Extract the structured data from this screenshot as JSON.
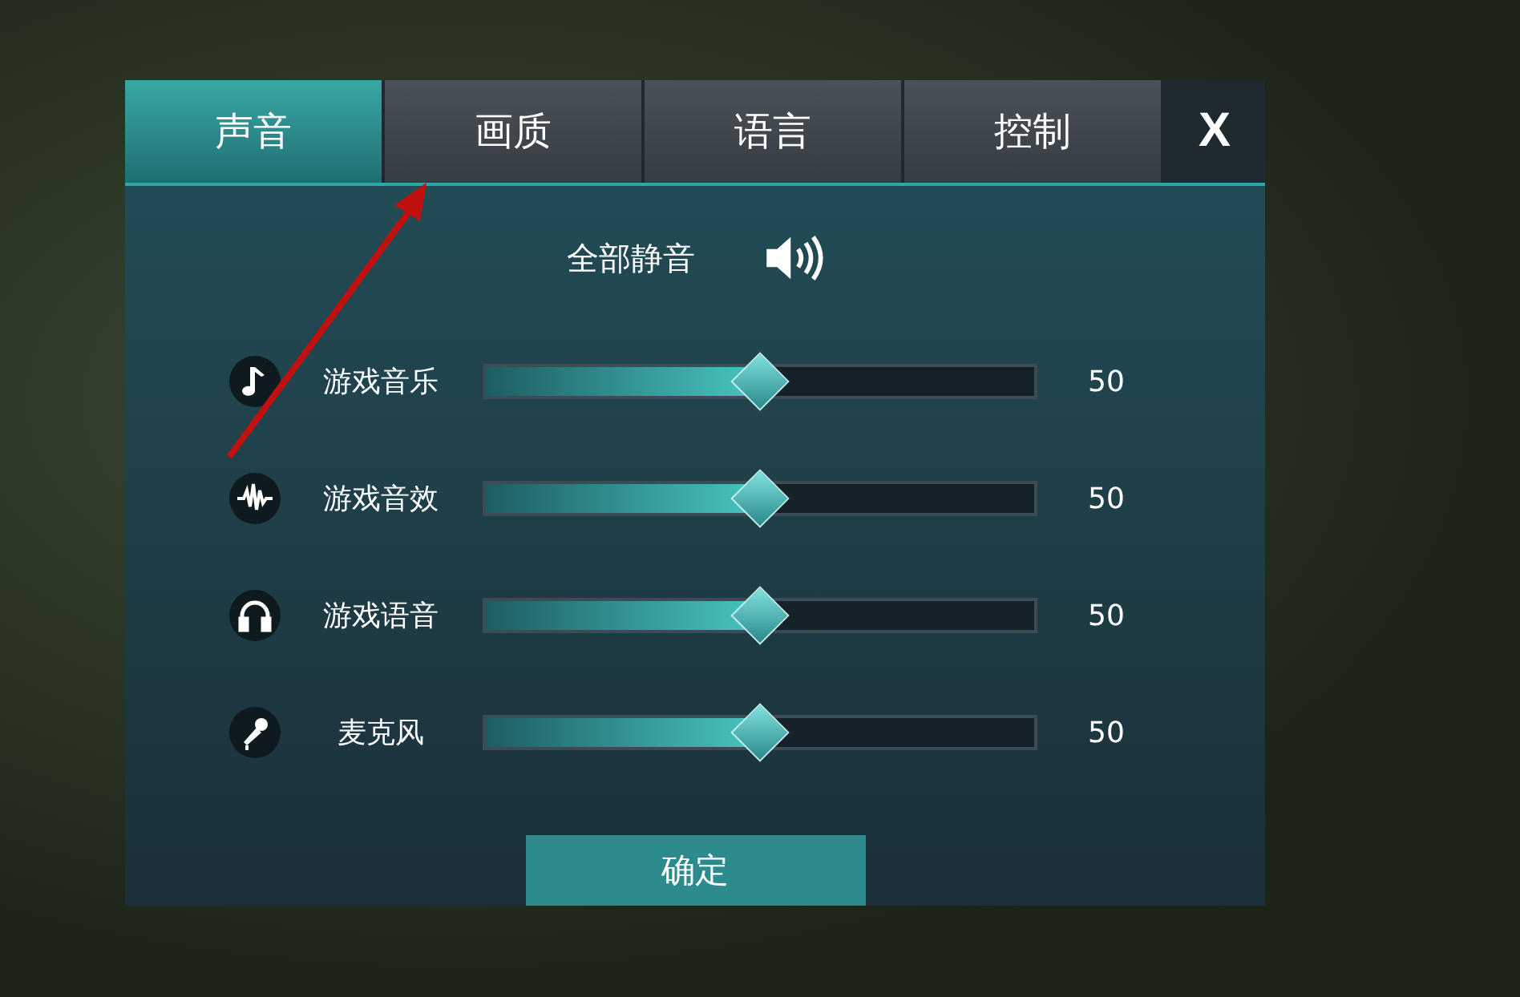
{
  "tabs": [
    {
      "label": "声音",
      "selected": true
    },
    {
      "label": "画质",
      "selected": false
    },
    {
      "label": "语言",
      "selected": false
    },
    {
      "label": "控制",
      "selected": false
    }
  ],
  "close": {
    "label": "X"
  },
  "mute_all": {
    "label": "全部静音",
    "muted": false
  },
  "channels": [
    {
      "kind": "music",
      "name": "游戏音乐",
      "level": 0.5,
      "reading": "50"
    },
    {
      "kind": "effects",
      "name": "游戏音效",
      "level": 0.5,
      "reading": "50"
    },
    {
      "kind": "voice",
      "name": "游戏语音",
      "level": 0.5,
      "reading": "50"
    },
    {
      "kind": "microphone",
      "name": "麦克风",
      "level": 0.5,
      "reading": "50"
    }
  ],
  "confirm_button": "确定"
}
